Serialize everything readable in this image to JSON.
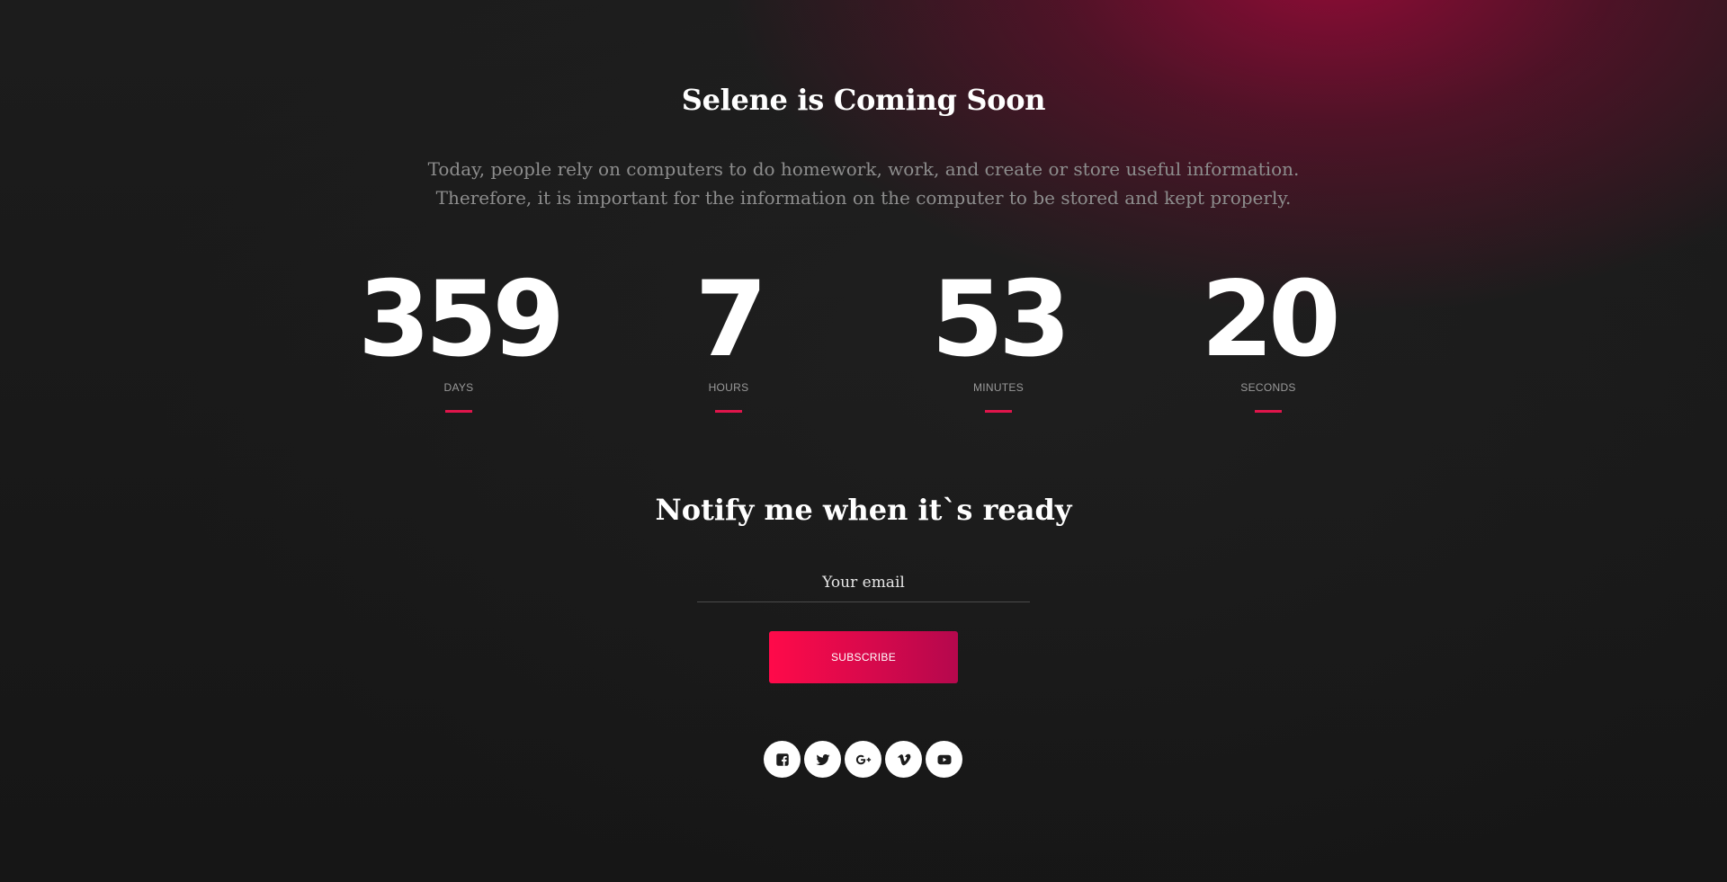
{
  "hero": {
    "title": "Selene is Coming Soon",
    "intro": "Today, people rely on computers to do homework, work, and create or store useful information. Therefore, it is important for the information on the computer to be stored and kept properly."
  },
  "countdown": [
    {
      "value": "359",
      "label": "DAYS"
    },
    {
      "value": "7",
      "label": "HOURS"
    },
    {
      "value": "53",
      "label": "MINUTES"
    },
    {
      "value": "20",
      "label": "SECONDS"
    }
  ],
  "notify": {
    "heading": "Notify me when it`s ready",
    "email_placeholder": "Your email",
    "email_value": "",
    "button_label": "SUBSCRIBE"
  },
  "social": [
    {
      "icon": "facebook-icon"
    },
    {
      "icon": "twitter-icon"
    },
    {
      "icon": "google-plus-icon"
    },
    {
      "icon": "vimeo-icon"
    },
    {
      "icon": "youtube-icon"
    }
  ],
  "colors": {
    "accent": "#e0154b",
    "button_start": "#ff0a4a",
    "button_end": "#b5084d",
    "background": "#181818",
    "glow": "#8c0a37"
  }
}
